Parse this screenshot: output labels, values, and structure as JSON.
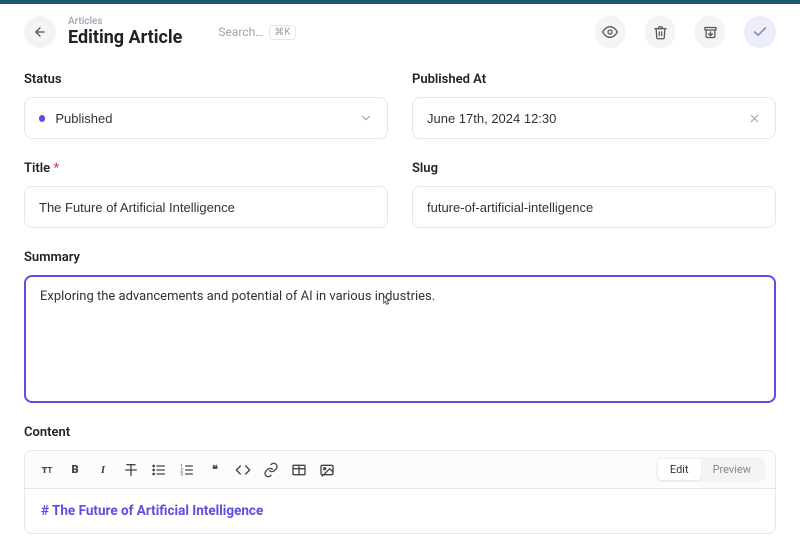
{
  "header": {
    "breadcrumb": "Articles",
    "title": "Editing Article",
    "search_placeholder": "Search…",
    "kbd": "⌘K"
  },
  "form": {
    "status": {
      "label": "Status",
      "value": "Published"
    },
    "published_at": {
      "label": "Published At",
      "value": "June 17th, 2024 12:30"
    },
    "title": {
      "label": "Title",
      "required_mark": "*",
      "value": "The Future of Artificial Intelligence"
    },
    "slug": {
      "label": "Slug",
      "value": "future-of-artificial-intelligence"
    },
    "summary": {
      "label": "Summary",
      "value": "Exploring the advancements and potential of AI in various industries."
    },
    "content": {
      "label": "Content",
      "tabs": {
        "edit": "Edit",
        "preview": "Preview"
      },
      "body_heading": "# The Future of Artificial Intelligence"
    }
  },
  "icons": {
    "back": "arrow-left",
    "preview": "eye",
    "delete": "trash",
    "archive": "archive",
    "save": "check"
  }
}
